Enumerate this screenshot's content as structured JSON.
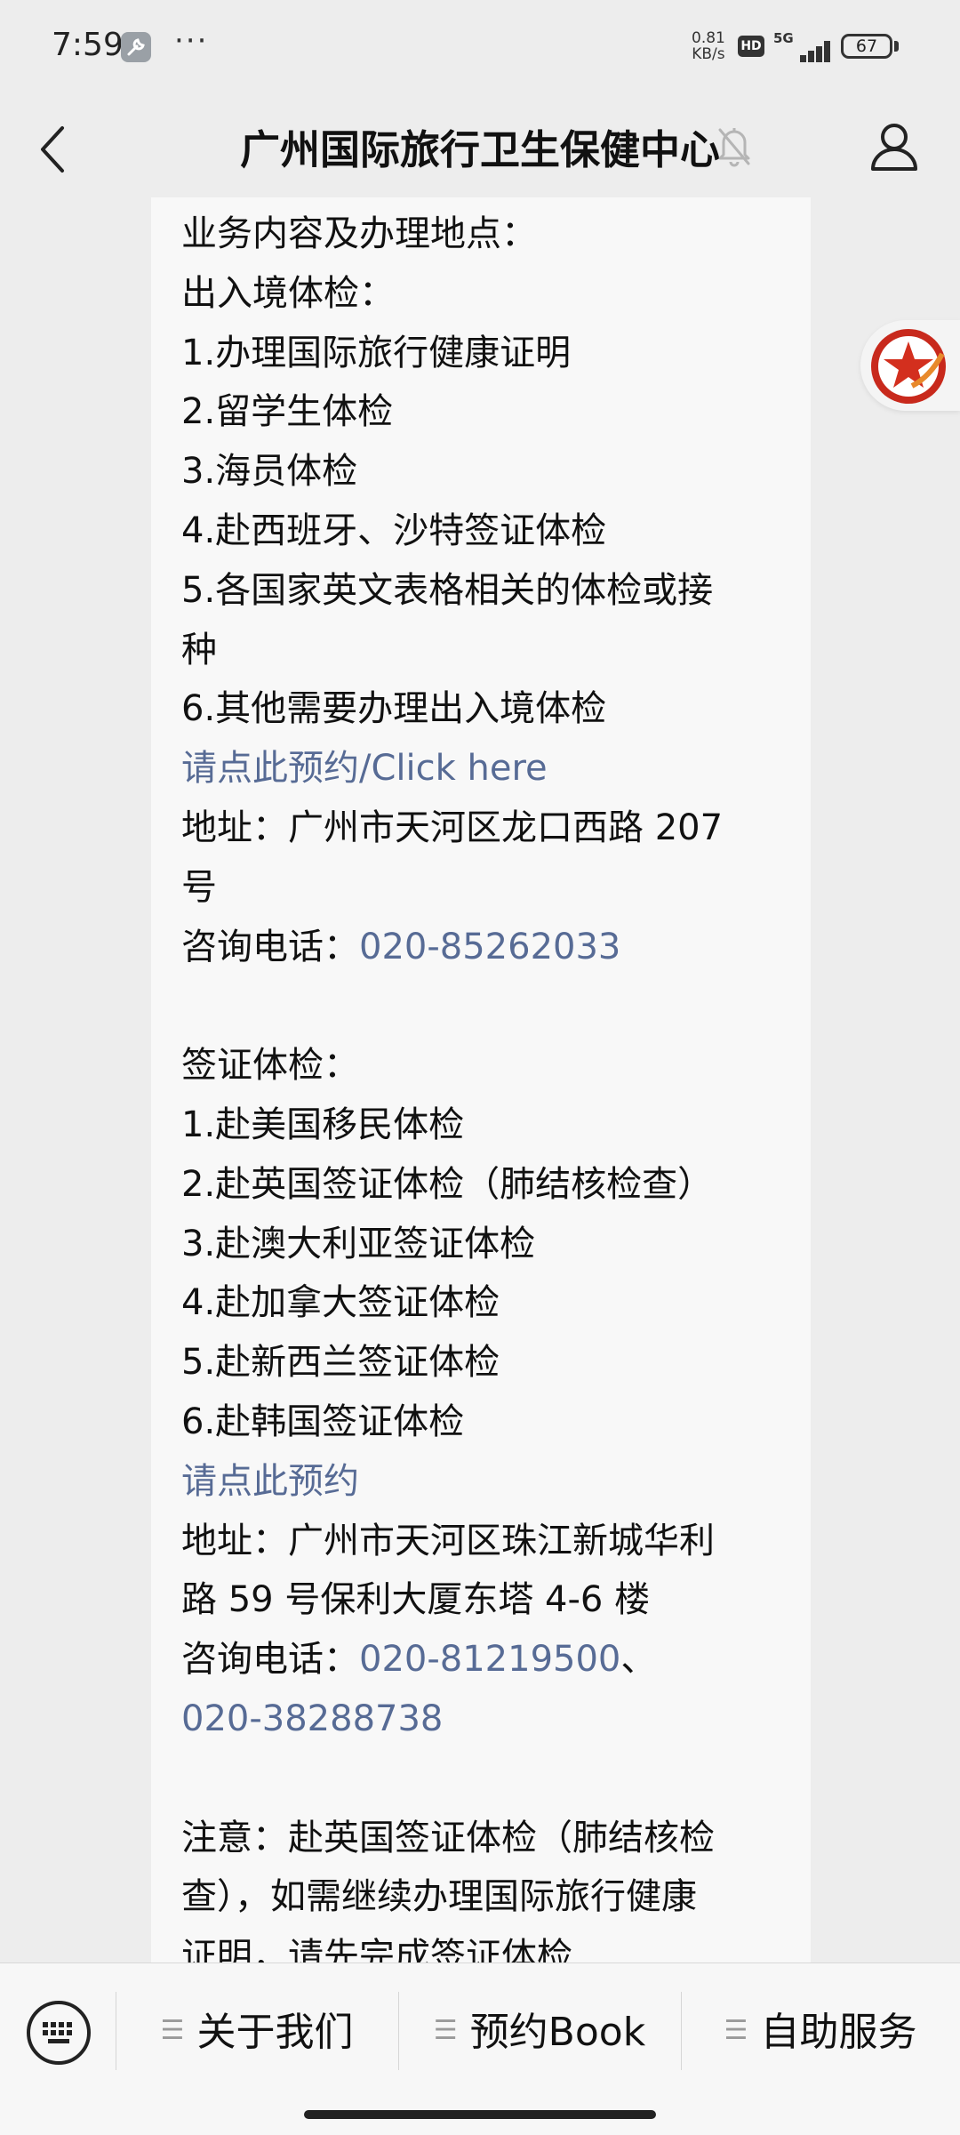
{
  "status_bar": {
    "time": "7:59",
    "net_speed_value": "0.81",
    "net_speed_unit": "KB/s",
    "hd": "HD",
    "network": "5G",
    "battery": "67"
  },
  "header": {
    "title": "广州国际旅行卫生保健中心"
  },
  "content": {
    "lines": [
      {
        "text": "业务内容及办理地点：",
        "type": "text"
      },
      {
        "text": "出入境体检：",
        "type": "text"
      },
      {
        "text": "1.办理国际旅行健康证明",
        "type": "text"
      },
      {
        "text": "2.留学生体检",
        "type": "text"
      },
      {
        "text": "3.海员体检",
        "type": "text"
      },
      {
        "text": "4.赴西班牙、沙特签证体检",
        "type": "text"
      },
      {
        "text": "5.各国家英文表格相关的体检或接",
        "type": "text"
      },
      {
        "text": "种",
        "type": "text"
      },
      {
        "text": "6.其他需要办理出入境体检",
        "type": "text"
      },
      {
        "text": "请点此预约/Click here",
        "type": "link"
      },
      {
        "text": "地址：广州市天河区龙口西路 207",
        "type": "text"
      },
      {
        "text": "号",
        "type": "text"
      },
      {
        "label": "咨询电话：",
        "phone": "020-85262033",
        "type": "phone"
      },
      {
        "type": "blank"
      },
      {
        "text": "签证体检：",
        "type": "text"
      },
      {
        "text": "1.赴美国移民体检",
        "type": "text"
      },
      {
        "text": "2.赴英国签证体检（肺结核检查）",
        "type": "text"
      },
      {
        "text": "3.赴澳大利亚签证体检",
        "type": "text"
      },
      {
        "text": "4.赴加拿大签证体检",
        "type": "text"
      },
      {
        "text": "5.赴新西兰签证体检",
        "type": "text"
      },
      {
        "text": "6.赴韩国签证体检",
        "type": "text"
      },
      {
        "text": "请点此预约",
        "type": "link"
      },
      {
        "text": "地址：广州市天河区珠江新城华利",
        "type": "text"
      },
      {
        "text": "路 59 号保利大厦东塔 4-6 楼",
        "type": "text"
      },
      {
        "label": "咨询电话：",
        "phone": "020-81219500",
        "suffix": "、",
        "type": "phone"
      },
      {
        "phone": "020-38288738",
        "type": "phone_only"
      },
      {
        "type": "blank"
      },
      {
        "text": "注意：赴英国签证体检（肺结核检",
        "type": "text"
      },
      {
        "text": "查），如需继续办理国际旅行健康",
        "type": "text"
      },
      {
        "text": "证明，请先完成签证体检",
        "type": "text"
      }
    ]
  },
  "bottom_menu": {
    "items": [
      {
        "label": "关于我们"
      },
      {
        "label": "预约Book"
      },
      {
        "label": "自助服务"
      }
    ]
  },
  "icons": {
    "back": "back-arrow-icon",
    "mute": "bell-muted-icon",
    "profile": "person-icon",
    "keyboard": "keyboard-icon",
    "menu": "hamburger-icon",
    "floating": "red-star-badge-icon"
  },
  "colors": {
    "link": "#576b95",
    "background": "#ededed",
    "card": "#f8f8f8"
  }
}
